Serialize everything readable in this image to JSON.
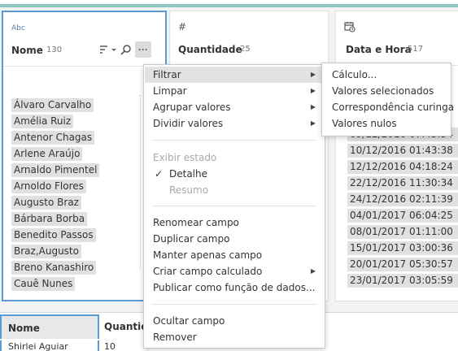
{
  "colors": {
    "accent_blue": "#5b9bd5",
    "teal_bar": "#8cc5c6",
    "value_bg": "#e0e0e0",
    "highlight": "#e2e2e2"
  },
  "cards": {
    "nome": {
      "type_icon": "Abc",
      "name": "Nome",
      "count": "130",
      "header_icons": [
        "sort-icon",
        "search-icon",
        "more-options-icon"
      ],
      "more_label": "···",
      "values": [
        "Álvaro Carvalho",
        "Amélia Ruiz",
        "Antenor Chagas",
        "Arlene Araújo",
        "Arnaldo Pimentel",
        "Arnoldo Flores",
        "Augusto Braz",
        "Bárbara Borba",
        "Benedito Passos",
        "Braz,Augusto",
        "Breno Kanashiro",
        "Cauê Nunes"
      ]
    },
    "quantidade": {
      "type_icon": "#",
      "name": "Quantidade",
      "count": "25"
    },
    "data_hora": {
      "type_icon": "calendar-clock-icon",
      "name": "Data e Hora",
      "count": "517",
      "values": [
        "09/12/2016 07:43:34",
        "10/12/2016 01:43:38",
        "12/12/2016 04:18:24",
        "22/12/2016 11:30:34",
        "24/12/2016 02:11:39",
        "04/01/2017 06:04:25",
        "08/01/2017 01:11:00",
        "15/01/2017 03:00:36",
        "20/01/2017 05:30:57",
        "23/01/2017 03:05:59"
      ]
    }
  },
  "bottom_grid": {
    "headers": [
      "Nome",
      "Quantid"
    ],
    "row1": [
      "Shirlei Aguiar",
      "10"
    ]
  },
  "context_menu": {
    "filtrar": "Filtrar",
    "limpar": "Limpar",
    "agrupar": "Agrupar valores",
    "dividir": "Dividir valores",
    "exibir_estado": "Exibir estado",
    "detalhe": "Detalhe",
    "resumo": "Resumo",
    "renomear": "Renomear campo",
    "duplicar": "Duplicar campo",
    "manter": "Manter apenas campo",
    "criar_calc": "Criar campo calculado",
    "publicar": "Publicar como função de dados...",
    "ocultar": "Ocultar campo",
    "remover": "Remover",
    "check_glyph": "✓",
    "arrow_glyph": "▶"
  },
  "submenu": {
    "calculo": "Cálculo...",
    "selecionados": "Valores selecionados",
    "curinga": "Correspondência curinga",
    "nulos": "Valores nulos"
  }
}
